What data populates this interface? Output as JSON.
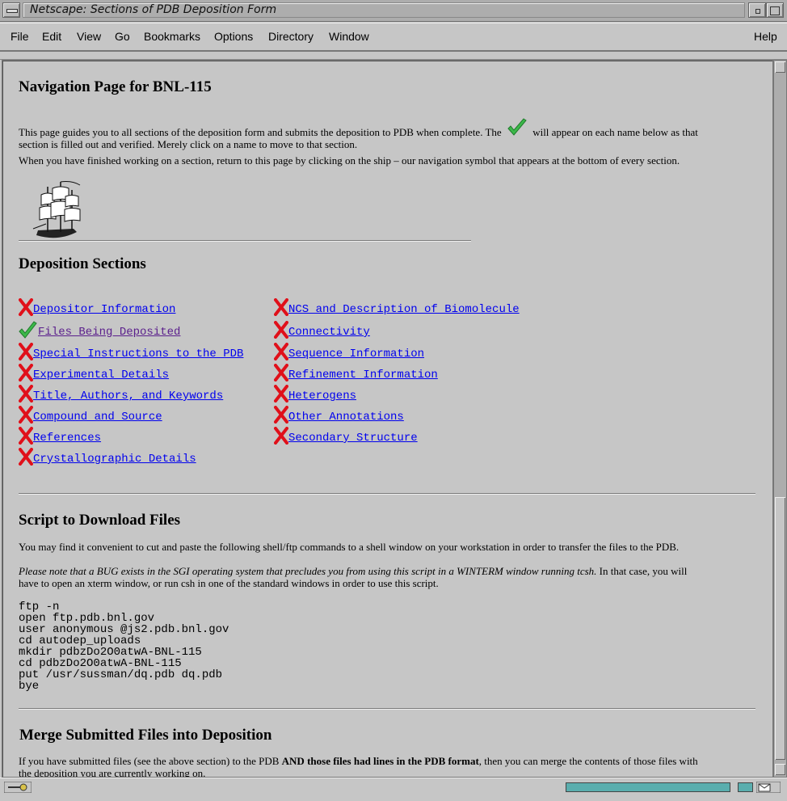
{
  "window": {
    "title": "Netscape: Sections of PDB Deposition Form"
  },
  "menu": {
    "file": "File",
    "edit": "Edit",
    "view": "View",
    "go": "Go",
    "bookmarks": "Bookmarks",
    "options": "Options",
    "directory": "Directory",
    "window": "Window",
    "help": "Help"
  },
  "page": {
    "heading": "Navigation Page for BNL-115",
    "intro_before": "This page guides you to all sections of the deposition form and submits the deposition to PDB when complete. The",
    "intro_after_line1": "will appear on each name below as that",
    "intro_after_line2": "section is filled out and verified. Merely click on a name to move to that section.",
    "return_text": "When you have finished working on a section, return to this page by clicking on the ship – our navigation symbol that appears at the bottom of every section.",
    "sections_heading": "Deposition Sections",
    "left_sections": [
      {
        "label": "Depositor Information",
        "status": "incomplete"
      },
      {
        "label": "Files Being Deposited",
        "status": "complete"
      },
      {
        "label": "Special Instructions to the PDB",
        "status": "incomplete"
      },
      {
        "label": "Experimental Details",
        "status": "incomplete"
      },
      {
        "label": "Title, Authors, and Keywords",
        "status": "incomplete"
      },
      {
        "label": "Compound and Source",
        "status": "incomplete"
      },
      {
        "label": "References",
        "status": "incomplete"
      },
      {
        "label": "Crystallographic Details",
        "status": "incomplete"
      }
    ],
    "right_sections": [
      {
        "label": "NCS and Description of Biomolecule",
        "status": "incomplete"
      },
      {
        "label": "Connectivity",
        "status": "incomplete"
      },
      {
        "label": "Sequence Information",
        "status": "incomplete"
      },
      {
        "label": "Refinement Information",
        "status": "incomplete"
      },
      {
        "label": "Heterogens",
        "status": "incomplete"
      },
      {
        "label": "Other Annotations",
        "status": "incomplete"
      },
      {
        "label": "Secondary Structure",
        "status": "incomplete"
      }
    ],
    "script_heading": "Script to Download Files",
    "script_intro": "You may find it convenient to cut and paste the following shell/ftp commands to a shell window on your workstation in order to transfer the files to the PDB.",
    "bug_note_italic": "Please note that a BUG exists in the SGI operating system that precludes you from using this script in a WINTERM window running tcsh.",
    "bug_note_rest_1": " In that case, you will",
    "bug_note_rest_2": "have to open an xterm window, or run csh in one of the standard windows in order to use this script.",
    "code_lines": [
      "ftp -n",
      "open ftp.pdb.bnl.gov",
      "user anonymous @js2.pdb.bnl.gov",
      "cd autodep_uploads",
      "mkdir pdbzDo2O0atwA-BNL-115",
      "cd pdbzDo2O0atwA-BNL-115",
      "put /usr/sussman/dq.pdb dq.pdb",
      "bye"
    ],
    "merge_heading": "Merge Submitted Files into Deposition",
    "merge_text_1": "If you have submitted files (see the above section) to the PDB ",
    "merge_bold_1": "AND",
    "merge_bold_2": " those files had lines in the PDB format",
    "merge_text_2": ", then you can merge the contents of those files with",
    "merge_text_3": "the deposition you are currently working on."
  },
  "colors": {
    "link": "#0000ee",
    "visited": "#5a1e8c",
    "x_mark": "#e0101a",
    "check": "#3cb84a",
    "progress": "#5aaeae"
  }
}
